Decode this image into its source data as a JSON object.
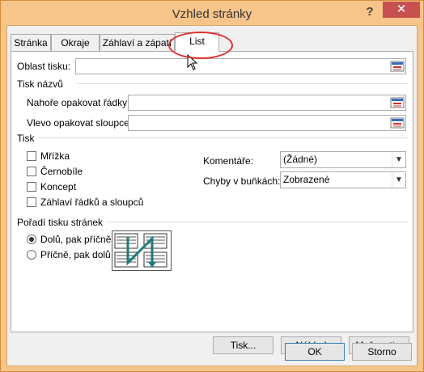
{
  "window": {
    "title": "Vzhled stránky",
    "help": "?",
    "close": "✕"
  },
  "tabs": [
    {
      "label": "Stránka",
      "active": false
    },
    {
      "label": "Okraje",
      "active": false
    },
    {
      "label": "Záhlaví a zápatí",
      "active": false
    },
    {
      "label": "List",
      "active": true
    }
  ],
  "print_area": {
    "label": "Oblast tisku:",
    "value": ""
  },
  "print_titles": {
    "heading": "Tisk názvů",
    "rows_label": "Nahoře opakovat řádky:",
    "rows_value": "",
    "cols_label": "Vlevo opakovat sloupce:",
    "cols_value": ""
  },
  "print": {
    "heading": "Tisk",
    "checkboxes": [
      {
        "label": "Mřížka",
        "checked": false
      },
      {
        "label": "Černobíle",
        "checked": false
      },
      {
        "label": "Koncept",
        "checked": false
      },
      {
        "label": "Záhlaví řádků a sloupců",
        "checked": false
      }
    ],
    "comments_label": "Komentáře:",
    "comments_value": "(Žádné)",
    "errors_label": "Chyby v buňkách:",
    "errors_value": "Zobrazené"
  },
  "page_order": {
    "heading": "Pořadí tisku stránek",
    "options": [
      {
        "label": "Dolů, pak příčně",
        "selected": true
      },
      {
        "label": "Příčně, pak dolů",
        "selected": false
      }
    ]
  },
  "panel_buttons": {
    "print": "Tisk...",
    "preview": "Náhled",
    "options": "Možnosti..."
  },
  "dialog_buttons": {
    "ok": "OK",
    "cancel": "Storno"
  },
  "colors": {
    "frame": "#f7c48a",
    "close": "#c75050",
    "highlight": "#e03030",
    "arrow": "#1f7a7a"
  }
}
